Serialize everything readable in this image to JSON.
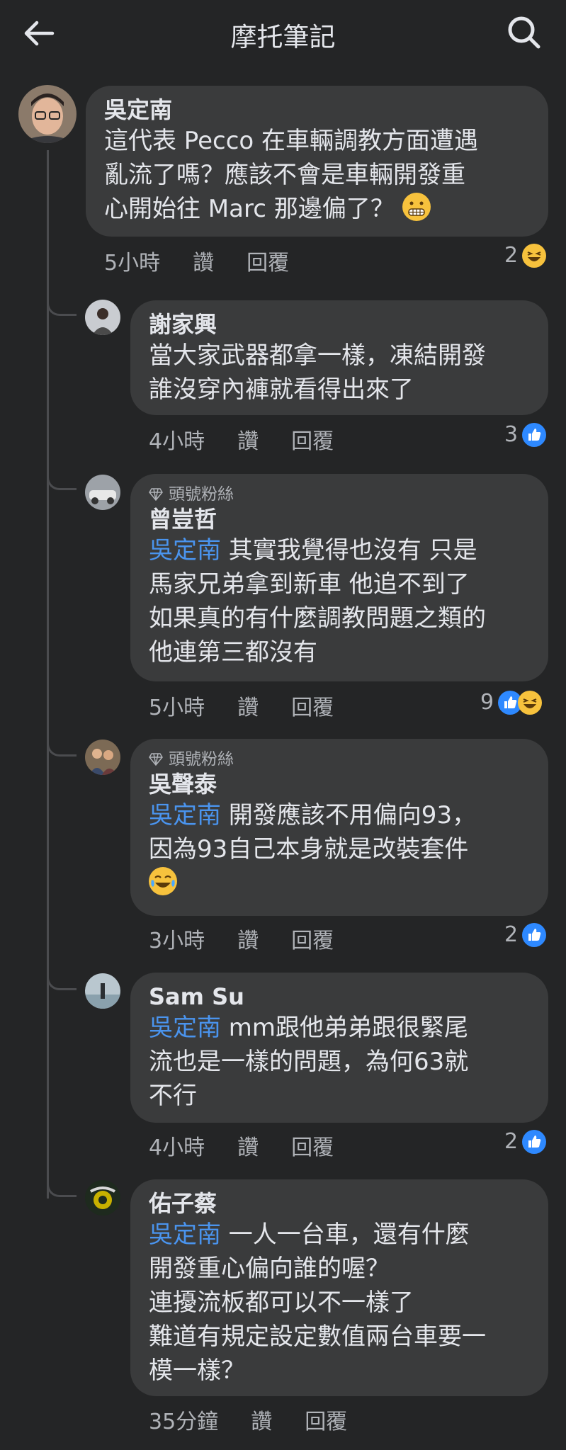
{
  "header": {
    "title": "摩托筆記",
    "back_icon": "arrow-left-icon",
    "search_icon": "search-icon"
  },
  "actions": {
    "like": "讚",
    "reply": "回覆"
  },
  "comments": [
    {
      "author": "吳定南",
      "text": [
        "這代表 Pecco 在車輛調教方面遭遇",
        "亂流了嗎？應該不會是車輛開發重",
        "心開始往 Marc 那邊偏了？"
      ],
      "time": "5小時",
      "reaction_count": "2",
      "reactions": [
        "haha"
      ]
    },
    {
      "author": "謝家興",
      "text": [
        "當大家武器都拿一樣，凍結開發",
        "誰沒穿內褲就看得出來了"
      ],
      "time": "4小時",
      "reaction_count": "3",
      "reactions": [
        "like"
      ]
    },
    {
      "badge": "頭號粉絲",
      "author": "曾豈哲",
      "mention": "吳定南",
      "text": [
        " 其實我覺得也沒有 只是",
        "馬家兄弟拿到新車 他追不到了",
        "如果真的有什麼調教問題之類的",
        "他連第三都沒有"
      ],
      "time": "5小時",
      "reaction_count": "9",
      "reactions": [
        "like",
        "haha"
      ]
    },
    {
      "badge": "頭號粉絲",
      "author": "吳聲泰",
      "mention": "吳定南",
      "text": [
        " 開發應該不用偏向93，",
        "因為93自己本身就是改裝套件"
      ],
      "time": "3小時",
      "reaction_count": "2",
      "reactions": [
        "like"
      ]
    },
    {
      "author": "Sam Su",
      "mention": "吳定南",
      "text": [
        " mm跟他弟弟跟很緊尾",
        "流也是一樣的問題，為何63就",
        "不行"
      ],
      "time": "4小時",
      "reaction_count": "2",
      "reactions": [
        "like"
      ]
    },
    {
      "author": "佑子蔡",
      "mention": "吳定南",
      "text": [
        " 一人一台車，還有什麼",
        "開發重心偏向誰的喔？",
        "連擾流板都可以不一樣了",
        "難道有規定設定數值兩台車要一",
        "模一樣？"
      ],
      "time": "35分鐘"
    }
  ]
}
